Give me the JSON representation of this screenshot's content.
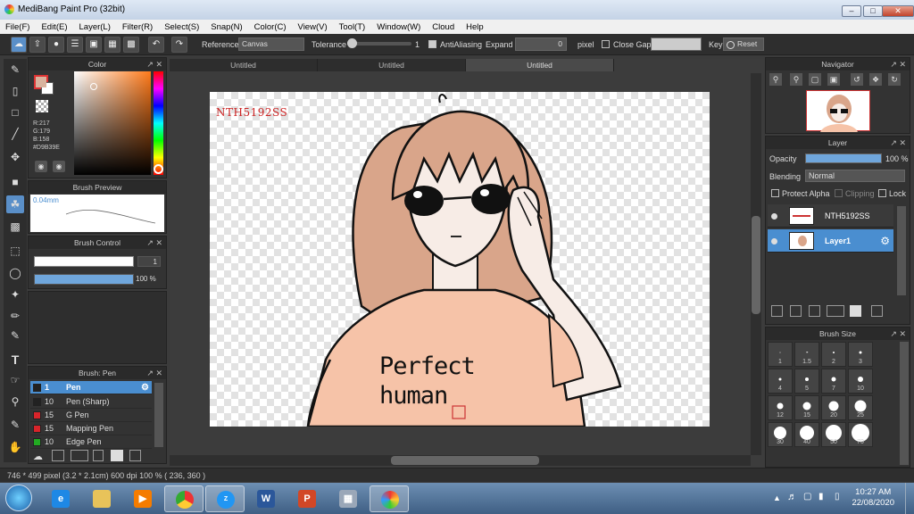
{
  "window": {
    "title": "MediBang Paint Pro (32bit)"
  },
  "menu": [
    "File(F)",
    "Edit(E)",
    "Layer(L)",
    "Filter(R)",
    "Select(S)",
    "Snap(N)",
    "Color(C)",
    "View(V)",
    "Tool(T)",
    "Window(W)",
    "Cloud",
    "Help"
  ],
  "toolbar": {
    "reference_label": "Reference",
    "reference_value": "Canvas",
    "tolerance_label": "Tolerance",
    "tolerance_value": "1",
    "antialiasing_label": "AntiAliasing",
    "expand_label": "Expand",
    "expand_value": "0",
    "expand_unit": "pixel",
    "close_gaps_label": "Close Gaps",
    "key_label": "Key",
    "reset_label": "Reset"
  },
  "color_panel": {
    "title": "Color",
    "r": "R:217",
    "g": "G:179",
    "b": "B:158",
    "hex": "#D9B39E",
    "fg_color": "#D9B39E"
  },
  "brush_preview": {
    "title": "Brush Preview",
    "size": "0.04mm"
  },
  "brush_control": {
    "title": "Brush Control",
    "size_value": "1",
    "opacity_value": "100 %"
  },
  "brush_list": {
    "title": "Brush: Pen",
    "items": [
      {
        "size": "1",
        "name": "Pen",
        "color": "#222222",
        "active": true
      },
      {
        "size": "10",
        "name": "Pen (Sharp)",
        "color": "#222222"
      },
      {
        "size": "15",
        "name": "G Pen",
        "color": "#d8242a"
      },
      {
        "size": "15",
        "name": "Mapping Pen",
        "color": "#d8242a"
      },
      {
        "size": "10",
        "name": "Edge Pen",
        "color": "#22aa22"
      }
    ]
  },
  "tabs": [
    "Untitled",
    "Untitled",
    "Untitled"
  ],
  "canvas": {
    "watermark": "NTH5192SS",
    "shirt_text_1": "Perfect",
    "shirt_text_2": "human"
  },
  "navigator": {
    "title": "Navigator"
  },
  "layer_panel": {
    "title": "Layer",
    "opacity_label": "Opacity",
    "opacity_value": "100 %",
    "opacity_fraction": 1.0,
    "blending_label": "Blending",
    "blending_value": "Normal",
    "protect_alpha_label": "Protect Alpha",
    "clipping_label": "Clipping",
    "lock_label": "Lock",
    "layers": [
      {
        "name": "NTH5192SS"
      },
      {
        "name": "Layer1",
        "active": true
      }
    ]
  },
  "brush_size": {
    "title": "Brush Size",
    "sizes": [
      "1",
      "1.5",
      "2",
      "3",
      "4",
      "5",
      "7",
      "10",
      "12",
      "15",
      "20",
      "25",
      "30",
      "40",
      "50",
      "70"
    ]
  },
  "statusbar": {
    "text": "746 * 499 pixel   (3.2 * 2.1cm)   600 dpi   100 %   ( 236, 360 )"
  },
  "taskbar": {
    "time": "10:27 AM",
    "date": "22/08/2020"
  }
}
